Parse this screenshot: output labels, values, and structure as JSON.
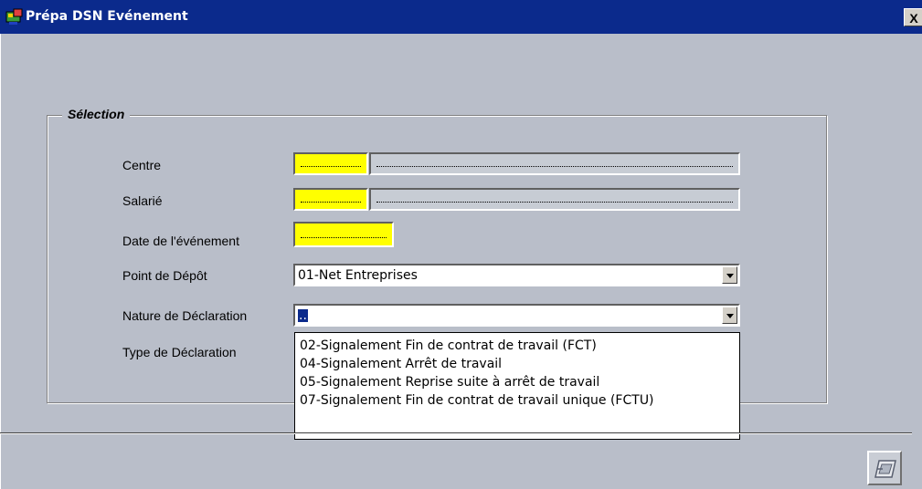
{
  "window": {
    "title": "Prépa DSN Evénement",
    "close_label": "X"
  },
  "group": {
    "legend": "Sélection"
  },
  "form": {
    "centre_label": "Centre",
    "salarie_label": "Salarié",
    "date_label": "Date de l'événement",
    "point_depot_label": "Point de Dépôt",
    "point_depot_value": "01-Net Entreprises",
    "nature_label": "Nature de Déclaration",
    "nature_value": "..",
    "type_label": "Type de Déclaration"
  },
  "dropdown": {
    "options": [
      "02-Signalement Fin de contrat de travail (FCT)",
      "04-Signalement Arrêt de travail",
      "05-Signalement Reprise suite à arrêt de travail",
      "07-Signalement Fin de contrat de travail unique (FCTU)"
    ]
  },
  "icons": {
    "app": "app-icon",
    "close": "close-icon",
    "dropdown_arrow": "chevron-down-icon",
    "bottom": "window-action-icon"
  }
}
